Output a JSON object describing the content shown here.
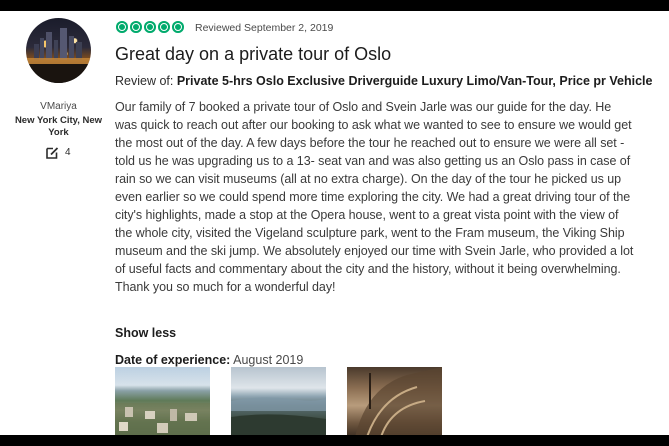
{
  "reviewer": {
    "username": "VMariya",
    "location": "New York City, New York",
    "contributions": "4",
    "contributions_icon": "edit-icon"
  },
  "review": {
    "rating_bubbles": 5,
    "rating_color": "#00aa6c",
    "reviewed_date": "Reviewed September 2, 2019",
    "title": "Great day on a private tour of Oslo",
    "review_of_label": "Review of:",
    "review_of_link": "Private 5-hrs Oslo Exclusive Driverguide Luxury Limo/Van-Tour, Price pr Vehicle",
    "body": "Our family of 7 booked a private tour of Oslo and Svein Jarle was our guide for the day. He was quick to reach out after our booking to ask what we wanted to see to ensure we would get the most out of the day. A few days before the tour he reached out to ensure we were all set - told us he was upgrading us to a 13- seat van and was also getting us an Oslo pass in case of rain so we can visit museums (all at no extra charge). On the day of the tour he picked us up even earlier so we could spend more time exploring the city. We had a great driving tour of the city's highlights, made a stop at the Opera house, went to a great vista point with the view of the whole city, visited the Vigeland sculpture park, went to the Fram museum, the Viking Ship museum and the ski jump. We absolutely enjoyed our time with Svein Jarle, who provided a lot of useful facts and commentary about the city and the history, without it being overwhelming. Thank you so much for a wonderful day!",
    "show_less": "Show less",
    "date_of_experience_label": "Date of experience:",
    "date_of_experience_value": "August 2019"
  }
}
